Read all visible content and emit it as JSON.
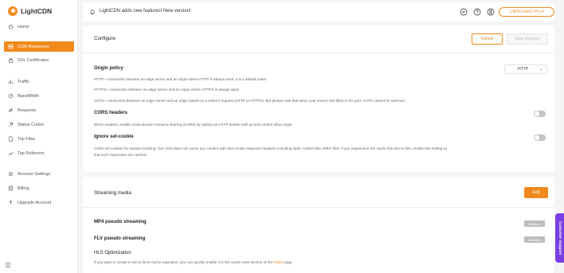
{
  "app": {
    "name": "LightCDN",
    "brand_color": "#f08a1c"
  },
  "sidebar": {
    "items": [
      {
        "label": "Home",
        "icon": "home-icon"
      },
      {
        "label": "CDN Resources",
        "icon": "server-icon",
        "active": true
      },
      {
        "label": "SSL Certificates",
        "icon": "ssl-icon"
      },
      {
        "label": "Traffic",
        "icon": "bar-chart-icon"
      },
      {
        "label": "BandWidth",
        "icon": "bandwidth-icon"
      },
      {
        "label": "Requests",
        "icon": "requests-icon"
      },
      {
        "label": "Status Codes",
        "icon": "status-codes-icon"
      },
      {
        "label": "Top Files",
        "icon": "file-icon"
      },
      {
        "label": "Top Referrers",
        "icon": "referrers-icon"
      },
      {
        "label": "Account Settings",
        "icon": "gear-icon"
      },
      {
        "label": "Billing",
        "icon": "billing-icon"
      },
      {
        "label": "Upgrade Account",
        "icon": "upgrade-icon"
      }
    ]
  },
  "topbar": {
    "announcement": "LightCDN adds new features! New version!",
    "plan_badge": "1.86% Used / Pro ▾"
  },
  "configure": {
    "title": "Configure",
    "cancel_label": "Cancel",
    "save_label": "Save changes",
    "origin_policy": {
      "title": "Origin policy",
      "selected": "HTTP",
      "desc_http": "HTTP—connection between an edge server and an origin where HTTP is always used, it is a default value.",
      "desc_https": "HTTPS—connection between an edge server and an origin where HTTPS is always used.",
      "desc_auto": "AUTO—connection between an edge server and an origin based on a visitor's request (HTTP or HTTPS). But please note that when your source has filled in the port, AUTO cannot be selected."
    },
    "cors": {
      "title": "CORS headers",
      "desc": "When enabled, enable cross domain resource sharing (CORS) by adding an HTTP header with access control allow origin",
      "enabled": false
    },
    "ignore_cookie": {
      "title": "Ignore set-cookie",
      "desc_line1": "CDNs set cookies for session tracking. Our CDN does not cache any content with Set-Cookie response headers, including static content like JPEG files. If you experience 0% cache hits due to this, enable this setting so",
      "desc_line2": "that such responses are cached.",
      "enabled": false
    }
  },
  "streaming": {
    "title": "Streaming media",
    "edit_label": "Edit",
    "mp4": {
      "title": "MP4 pseudo streaming",
      "status": "Disabled"
    },
    "flv": {
      "title": "FLV pseudo streaming",
      "status": "Disabled"
    },
    "hls": {
      "title": "HLS Optimization",
      "desc_before": "If you want to create a rule to force cache expiration, you can quickly enable it in the cache rules section of the",
      "desc_link": "Rules",
      "desc_after": "page."
    }
  },
  "support": {
    "label": "Customer Support"
  }
}
